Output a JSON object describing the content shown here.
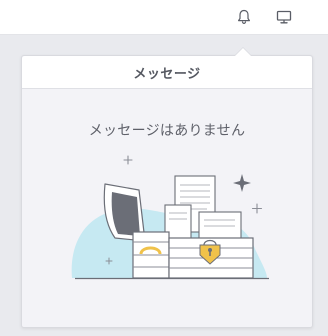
{
  "topbar": {
    "icons": [
      "bell-icon",
      "monitor-icon"
    ]
  },
  "popover": {
    "title": "メッセージ",
    "empty_message": "メッセージはありません",
    "illustration": "empty-treasure-chest-with-papers"
  },
  "colors": {
    "accent_blue": "#c6e9f2",
    "lock_gold": "#f0c24a",
    "line_gray": "#6b6e77"
  }
}
